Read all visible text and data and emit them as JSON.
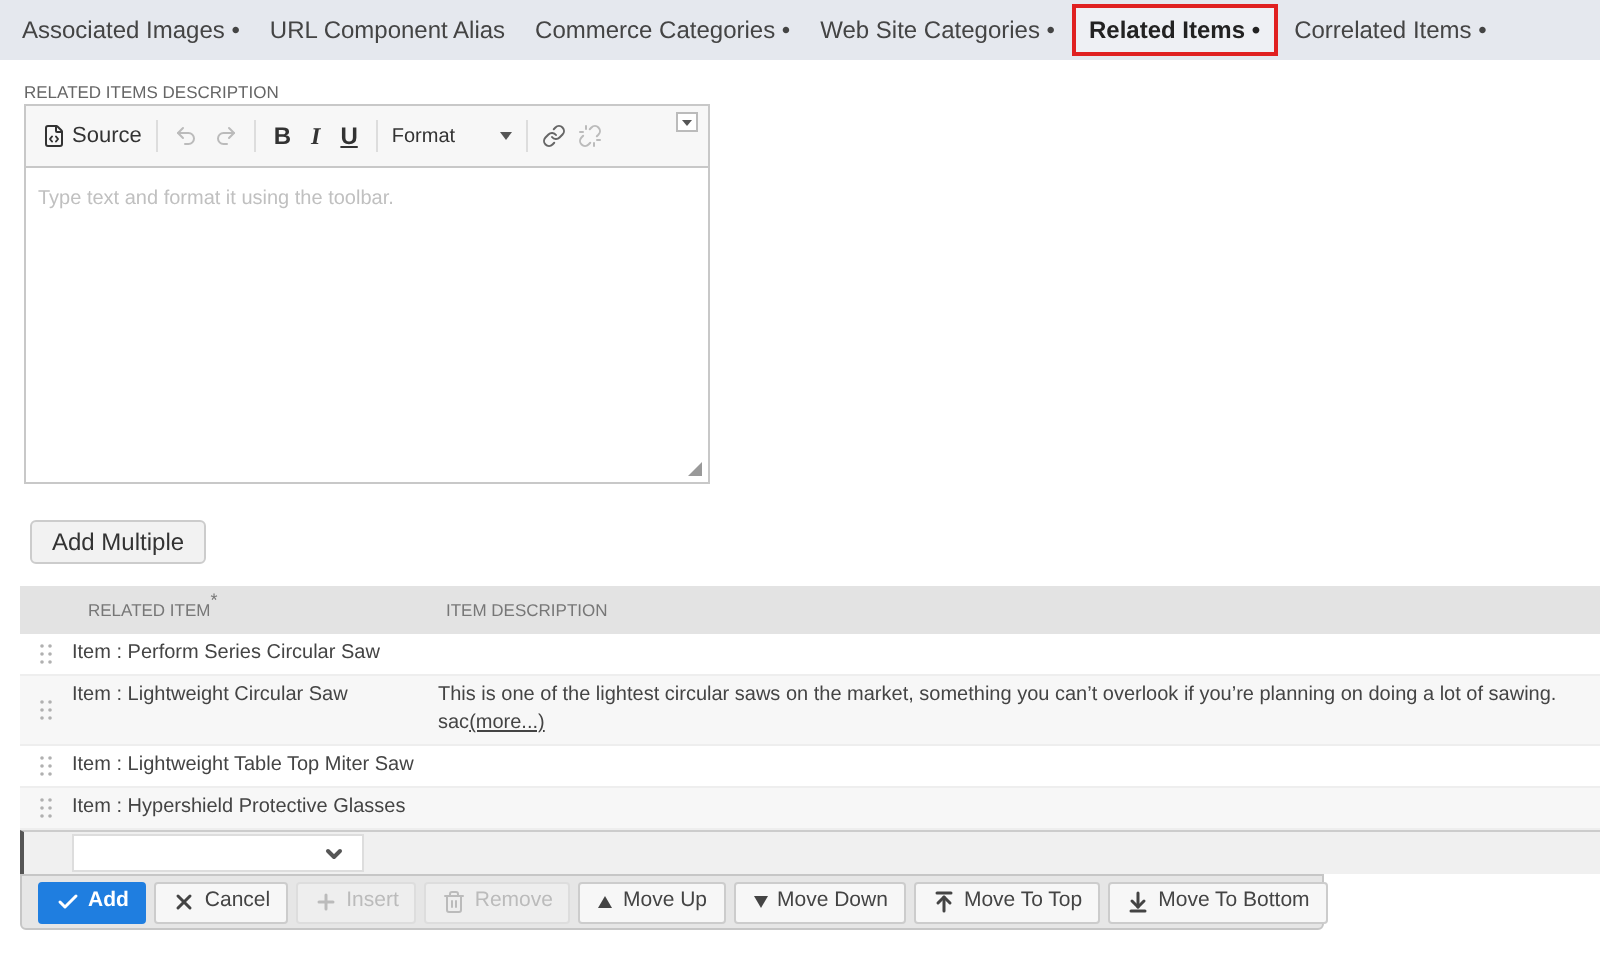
{
  "tabs": [
    {
      "label": "Associated Images •",
      "selected": false
    },
    {
      "label": "URL Component Alias",
      "selected": false
    },
    {
      "label": "Commerce Categories •",
      "selected": false
    },
    {
      "label": "Web Site Categories •",
      "selected": false
    },
    {
      "label": "Related Items •",
      "selected": true
    },
    {
      "label": "Correlated Items •",
      "selected": false
    }
  ],
  "editor": {
    "label": "RELATED ITEMS DESCRIPTION",
    "source": "Source",
    "bold": "B",
    "italic": "I",
    "underline": "U",
    "format": "Format",
    "placeholder": "Type text and format it using the toolbar."
  },
  "add_multiple": "Add Multiple",
  "table": {
    "columns": [
      {
        "label": "RELATED ITEM",
        "required_mark": "*"
      },
      {
        "label": "ITEM DESCRIPTION"
      }
    ],
    "rows": [
      {
        "item": "Item : Perform Series Circular Saw",
        "description": "",
        "more": ""
      },
      {
        "item": "Item : Lightweight Circular Saw",
        "description": "This is one of the lightest circular saws on the market, something you can’t overlook if you’re planning on doing a lot of sawing. sac",
        "more": "(more...)"
      },
      {
        "item": "Item : Lightweight Table Top Miter Saw",
        "description": "",
        "more": ""
      },
      {
        "item": "Item : Hypershield Protective Glasses",
        "description": "",
        "more": ""
      }
    ]
  },
  "buttons": [
    {
      "kind": "add",
      "label": "Add",
      "disabled": false
    },
    {
      "kind": "cancel",
      "label": "Cancel",
      "disabled": false
    },
    {
      "kind": "insert",
      "label": "Insert",
      "disabled": true
    },
    {
      "kind": "remove",
      "label": "Remove",
      "disabled": true
    },
    {
      "kind": "up",
      "label": "Move Up",
      "disabled": false
    },
    {
      "kind": "down",
      "label": "Move Down",
      "disabled": false
    },
    {
      "kind": "top",
      "label": "Move To Top",
      "disabled": false
    },
    {
      "kind": "bottom",
      "label": "Move To Bottom",
      "disabled": false
    }
  ]
}
